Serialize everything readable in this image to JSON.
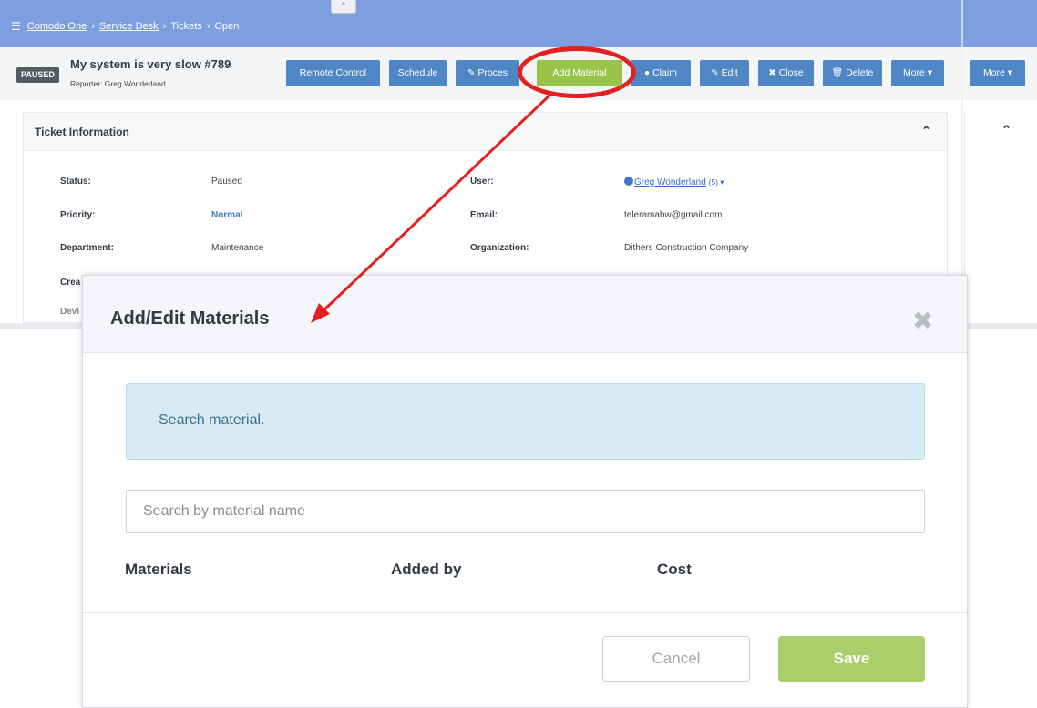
{
  "breadcrumb": {
    "menu_icon": "hamburger-icon",
    "items": [
      "Comodo One",
      "Service Desk",
      "Tickets",
      "Open"
    ],
    "separator": "›",
    "collapse_glyph": "⌃"
  },
  "ticket": {
    "status_badge": "PAUSED",
    "title": "My system is very slow #789",
    "reporter": "Reporter: Greg Wonderland"
  },
  "toolbar": {
    "remote_control": "Remote Control",
    "schedule": "Schedule",
    "process": "Proces",
    "add_material": "Add Material",
    "claim": "Claim",
    "edit": "Edit",
    "close": "Close",
    "delete": "Delete",
    "more": "More ▾",
    "more_right": "More ▾",
    "colors": {
      "primary": "#4f86c6",
      "add_material": "#99c44a",
      "annotation": "#e41f1f"
    }
  },
  "info": {
    "title": "Ticket Information",
    "fields": {
      "status_label": "Status:",
      "status_value": "Paused",
      "priority_label": "Priority:",
      "priority_value": "Normal",
      "department_label": "Department:",
      "department_value": "Maintenance",
      "created_label": "Crea",
      "device_label": "Devi",
      "user_label": "User:",
      "user_value": "Greg Wonderland",
      "user_count": "(5) ▾",
      "email_label": "Email:",
      "email_value": "teleramabw@gmail.com",
      "org_label": "Organization:",
      "org_value": "Dithers Construction Company"
    }
  },
  "modal": {
    "title": "Add/Edit Materials",
    "close_glyph": "✖",
    "alert": "Search material.",
    "search_placeholder": "Search by material name",
    "columns": [
      "Materials",
      "Added by",
      "Cost"
    ],
    "cancel": "Cancel",
    "save": "Save"
  }
}
